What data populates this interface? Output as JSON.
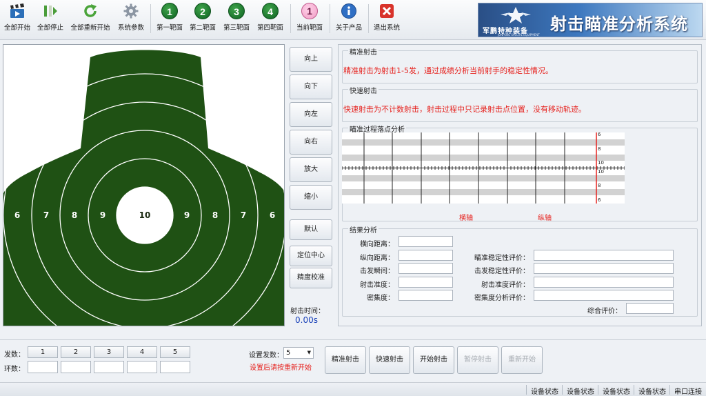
{
  "toolbar": {
    "items": [
      {
        "label": "全部开始",
        "icon": "clapper-icon"
      },
      {
        "label": "全部停止",
        "icon": "stop-icon"
      },
      {
        "label": "全部重新开始",
        "icon": "refresh-icon"
      },
      {
        "label": "系统参数",
        "icon": "gear-icon"
      },
      {
        "label": "第一靶面",
        "icon": "1"
      },
      {
        "label": "第二靶面",
        "icon": "2"
      },
      {
        "label": "第三靶面",
        "icon": "3"
      },
      {
        "label": "第四靶面",
        "icon": "4"
      },
      {
        "label": "当前靶面",
        "icon": "1"
      },
      {
        "label": "关于产品",
        "icon": "info-icon"
      },
      {
        "label": "退出系统",
        "icon": "exit-icon"
      }
    ]
  },
  "brand": {
    "company": "军鹏特种装备",
    "company_en": "JUNPENG SPECIAL EQUIPMENT",
    "title": "射击瞄准分析系统"
  },
  "target": {
    "ring_labels": [
      "6",
      "7",
      "8",
      "9",
      "10",
      "9",
      "8",
      "7",
      "6"
    ],
    "color": "#1f5114"
  },
  "direction": {
    "up": "向上",
    "down": "向下",
    "left": "向左",
    "right": "向右",
    "zoom_in": "放大",
    "zoom_out": "缩小"
  },
  "side_buttons": {
    "default": "默认",
    "locate_center": "定位中心",
    "calibrate": "精度校准"
  },
  "shot_time": {
    "label": "射击时间：",
    "value": "0.00s"
  },
  "precision": {
    "title": "精准射击",
    "desc": "精准射击为射击1-5发，通过成绩分析当前射手的稳定性情况。"
  },
  "rapid": {
    "title": "快速射击",
    "desc": "快速射击为不计数射击，射击过程中只记录射击点位置，没有移动轨迹。"
  },
  "aim_analysis": {
    "title": "瞄准过程落点分析",
    "scale_labels": [
      "6",
      "8",
      "10",
      "10",
      "8",
      "6"
    ],
    "h_axis": "横轴",
    "v_axis": "纵轴"
  },
  "results": {
    "title": "结果分析",
    "left_fields": [
      {
        "label": "横向距离：",
        "value": ""
      },
      {
        "label": "纵向距离：",
        "value": ""
      },
      {
        "label": "击发瞬间：",
        "value": ""
      },
      {
        "label": "射击准度：",
        "value": ""
      },
      {
        "label": "密集度：",
        "value": ""
      }
    ],
    "right_fields": [
      {
        "label": "瞄准稳定性评价：",
        "value": ""
      },
      {
        "label": "击发稳定性评价：",
        "value": ""
      },
      {
        "label": "射击准度评价：",
        "value": ""
      },
      {
        "label": "密集度分析评价：",
        "value": ""
      }
    ],
    "overall_label": "综合评价：",
    "overall_value": ""
  },
  "bottom": {
    "shots_label": "发数：",
    "rings_label": "环数：",
    "shot_numbers": [
      "1",
      "2",
      "3",
      "4",
      "5"
    ],
    "ring_values": [
      "",
      "",
      "",
      "",
      ""
    ],
    "set_count_label": "设置发数：",
    "set_count_value": "5",
    "set_hint": "设置后请按重新开始"
  },
  "actions": {
    "precision": "精准射击",
    "rapid": "快速射击",
    "start": "开始射击",
    "pause": "暂停射击",
    "restart": "重新开始"
  },
  "status": {
    "items": [
      "设备状态",
      "设备状态",
      "设备状态",
      "设备状态",
      "串口连接"
    ]
  }
}
